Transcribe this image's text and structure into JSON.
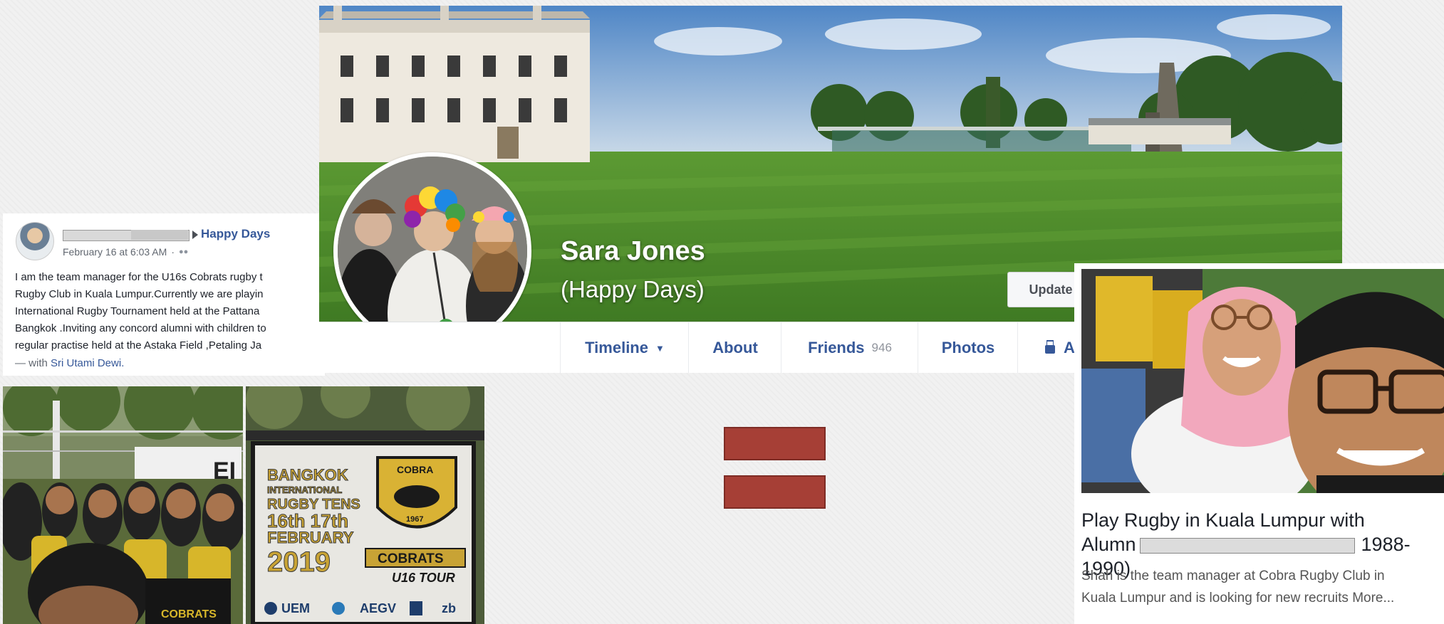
{
  "post": {
    "group_name": "Happy Days",
    "date": "February 16 at 6:03 AM",
    "body_lines": [
      "I am the team manager for the U16s Cobrats rugby t",
      "Rugby Club in Kuala Lumpur.Currently we are playin",
      "International Rugby Tournament held at the Pattana",
      "Bangkok .Inviting any concord alumni with children to",
      "regular practise held at the Astaka Field ,Petaling Ja"
    ],
    "with_prefix": "— with",
    "with_name": "Sri Utami Dewi."
  },
  "photos": {
    "banner_lines": [
      "BANGKOK",
      "INTERNATIONAL",
      "RUGBY TENS",
      "16th 17th",
      "FEBRUARY",
      "2019"
    ],
    "crest_top": "COBRA",
    "crest_year": "1967",
    "ribbon": "COBRATS",
    "tour": "U16 TOUR",
    "sponsors": [
      "UEM",
      "AEGV",
      "zb"
    ],
    "shirt_text": "COBRATS"
  },
  "profile": {
    "name": "Sara Jones",
    "subtitle": "(Happy Days)",
    "update_label": "Update",
    "nav": {
      "timeline": "Timeline",
      "about": "About",
      "friends": "Friends",
      "friends_count": "946",
      "photos": "Photos",
      "more": "Ar"
    }
  },
  "card": {
    "title": "Play Rugby in Kuala Lumpur with Alumn 1988-1990)",
    "title_line1": "Play Rugby in Kuala Lumpur with",
    "title_line2_a": "Alumn",
    "title_line2_b": "1988-1990)",
    "desc_line1": "Shah is the team manager at Cobra Rugby Club in",
    "desc_line2": "Kuala Lumpur and is looking for new recruits More..."
  },
  "colors": {
    "link_blue": "#365899",
    "equals_red": "#a63f36",
    "grass": "#4f8f2c",
    "sky": "#5f8fc4"
  }
}
